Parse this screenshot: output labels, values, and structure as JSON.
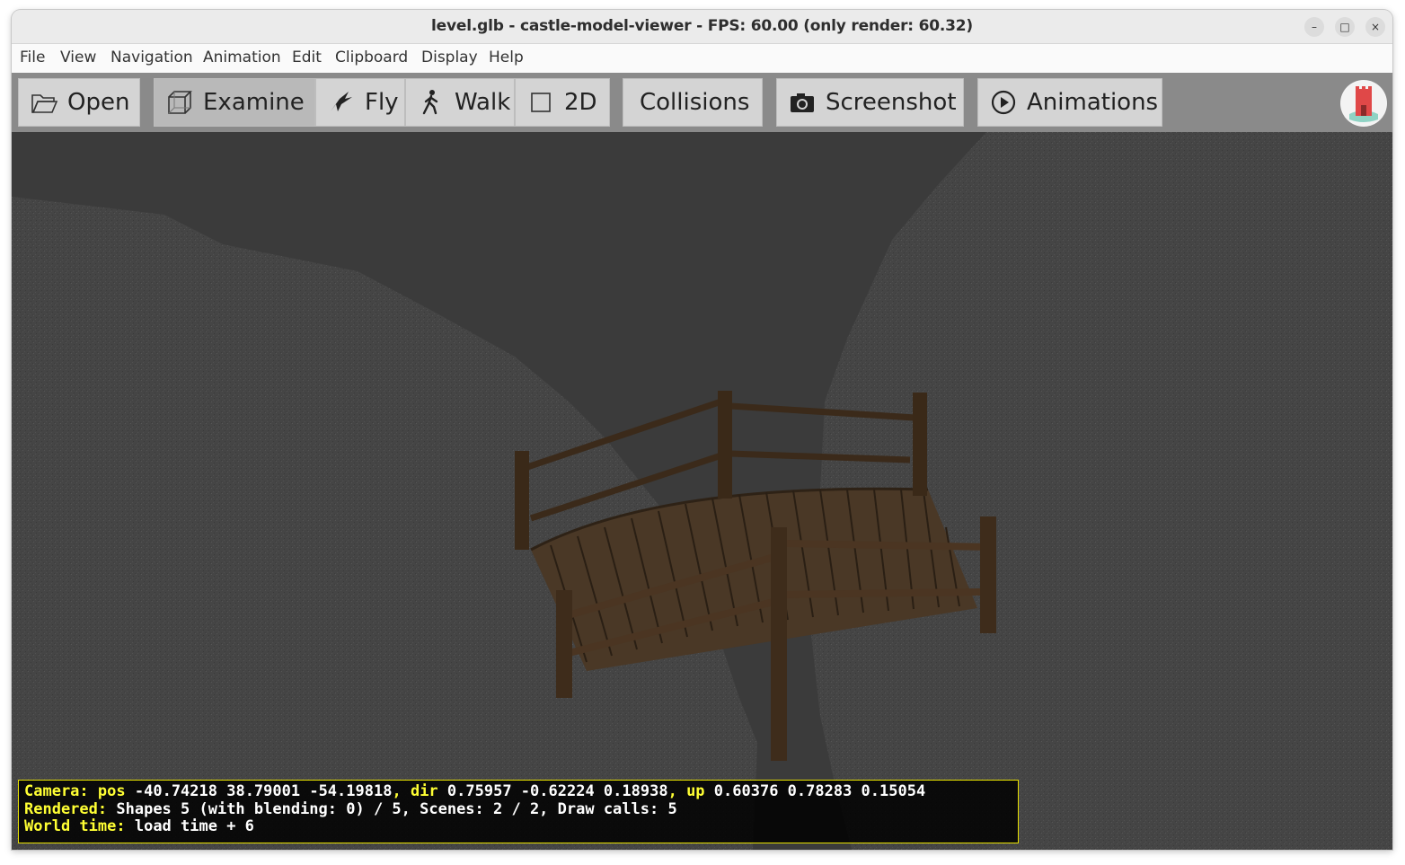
{
  "window": {
    "title": "level.glb - castle-model-viewer - FPS: 60.00 (only render: 60.32)",
    "controls": {
      "minimize": "–",
      "maximize": "□",
      "close": "×"
    }
  },
  "menu": [
    "File",
    "View",
    "Navigation",
    "Animation",
    "Edit",
    "Clipboard",
    "Display",
    "Help"
  ],
  "toolbar": {
    "open": "Open",
    "examine": "Examine",
    "fly": "Fly",
    "walk": "Walk",
    "twod": "2D",
    "collisions": "Collisions",
    "screenshot": "Screenshot",
    "animations": "Animations"
  },
  "hud": {
    "line1": {
      "camera_label": "Camera:",
      "pos_label": "pos",
      "pos": "-40.74218 38.79001 -54.19818",
      "comma1": ",",
      "dir_label": "dir",
      "dir": "0.75957 -0.62224 0.18938",
      "comma2": ",",
      "up_label": "up",
      "up": "0.60376 0.78283 0.15054"
    },
    "line2": {
      "label": "Rendered:",
      "text": "Shapes 5 (with blending: 0) / 5, Scenes: 2 / 2, Draw calls: 5"
    },
    "line3": {
      "label": "World time:",
      "text": "load time + 6"
    }
  },
  "colors": {
    "toolbar_bg": "#8a8a8a",
    "button_bg": "#d4d4d4",
    "viewport_bg": "#3c3c3c",
    "hud_border": "#e8e200",
    "hud_label": "#ffff33",
    "wood": "#4a3826"
  }
}
